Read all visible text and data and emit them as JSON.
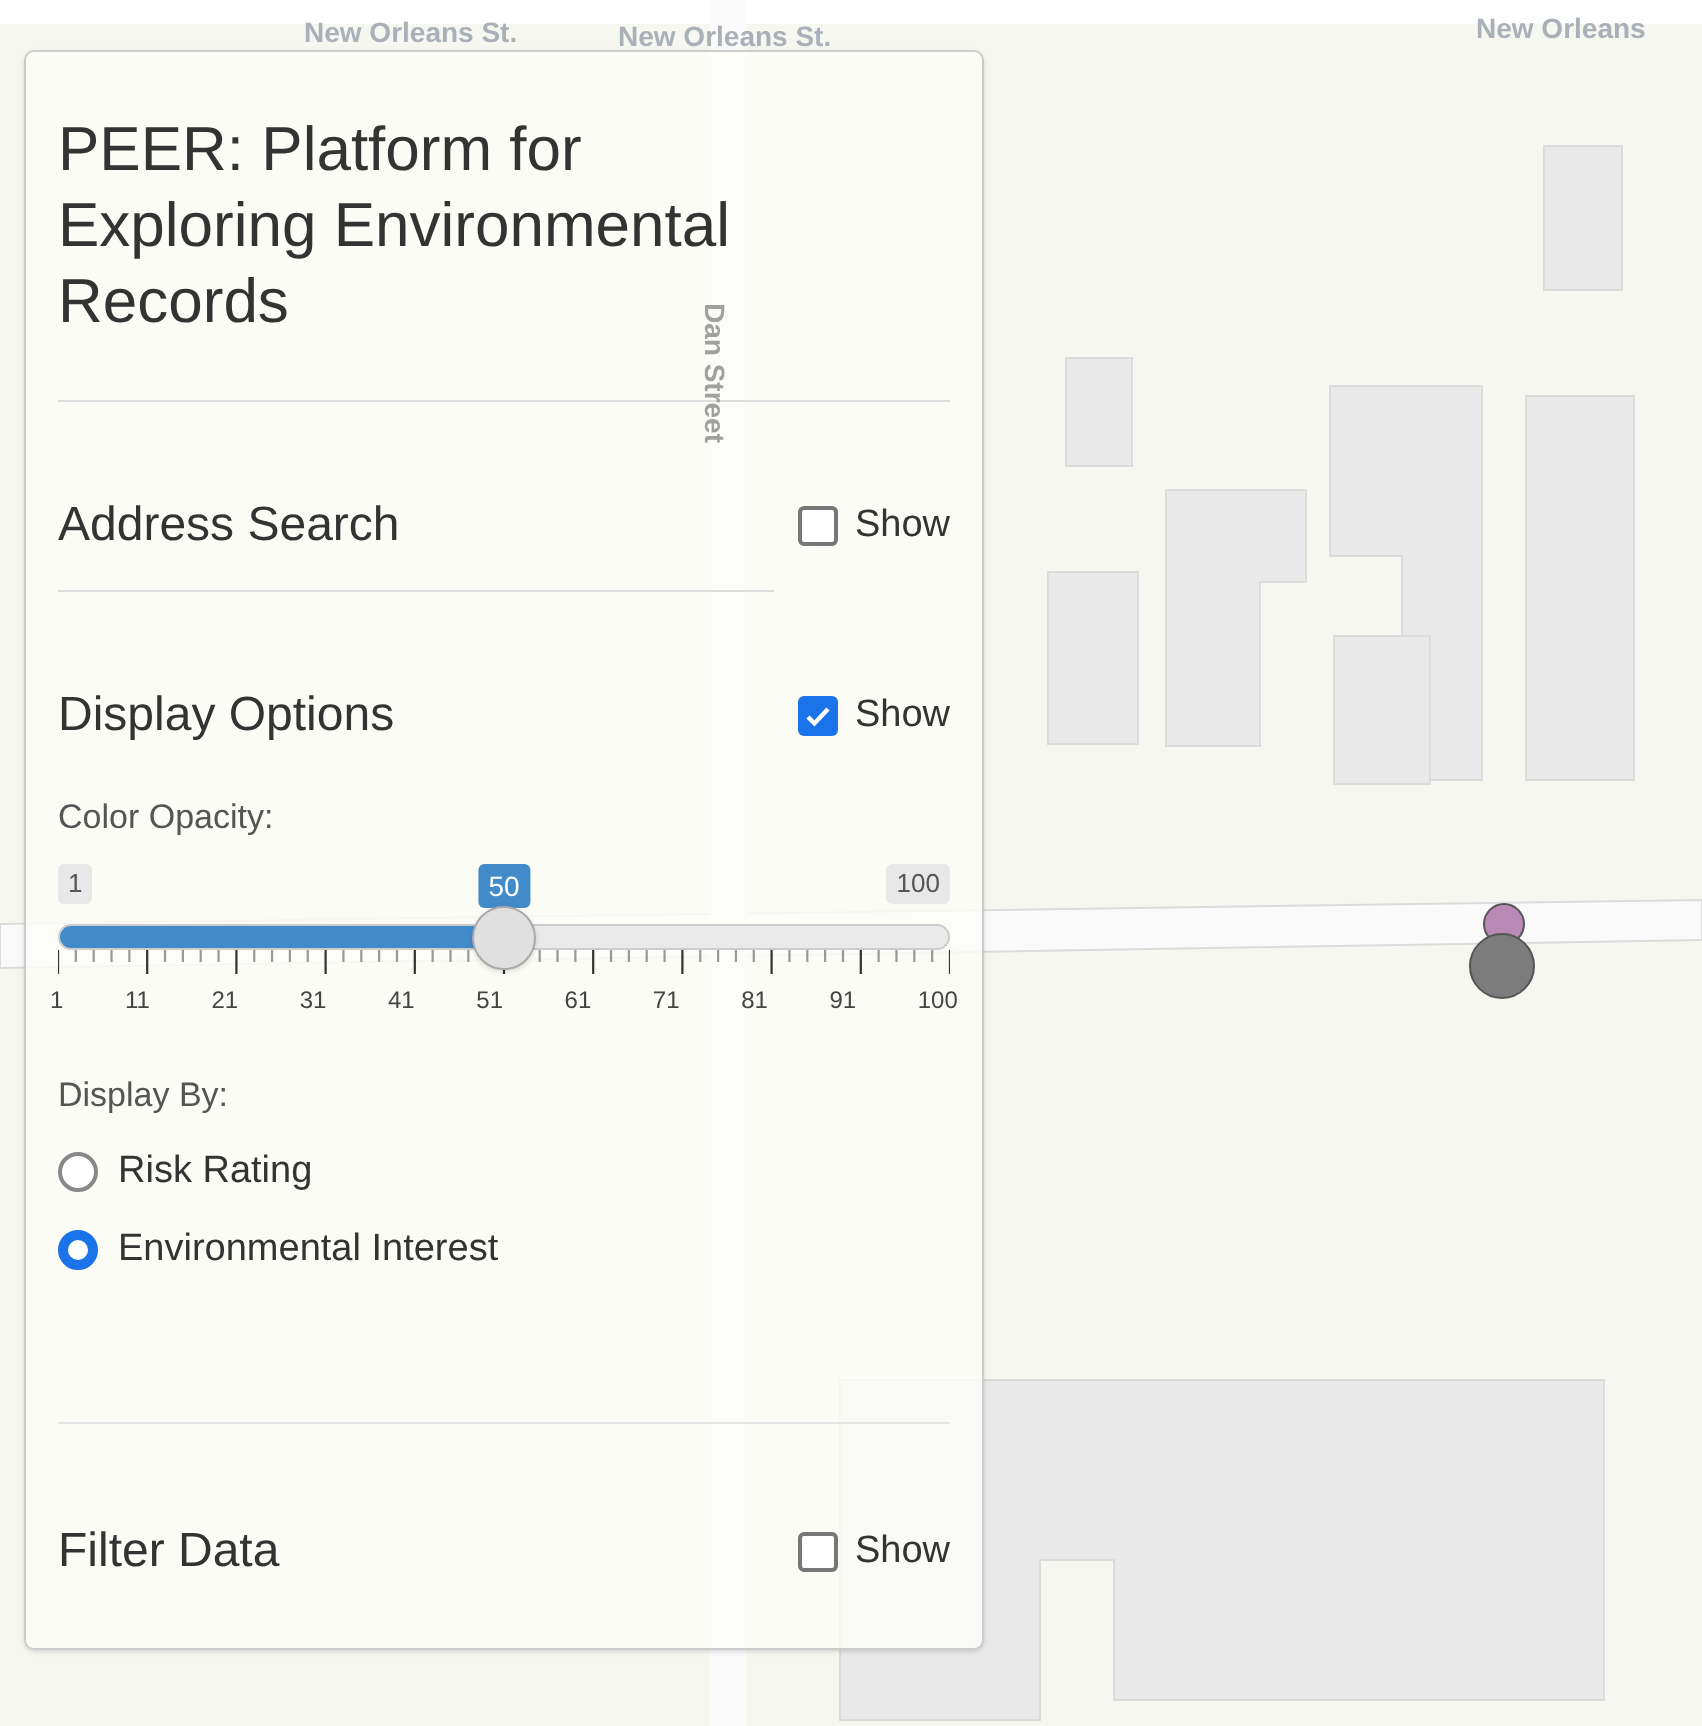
{
  "map": {
    "street_labels": [
      {
        "text": "New Orleans St.",
        "kind": "horizontal"
      },
      {
        "text": "New Orleans St.",
        "kind": "horizontal"
      },
      {
        "text": "New Orleans",
        "kind": "horizontal"
      },
      {
        "text": "Dan Street",
        "kind": "vertical"
      }
    ],
    "markers": [
      {
        "color": "#b98ab5"
      },
      {
        "color": "#7c7c7c"
      }
    ]
  },
  "panel": {
    "title": "PEER: Platform for Exploring Environmental Records",
    "sections": [
      {
        "title": "Address Search",
        "toggle_label": "Show",
        "checked": false
      },
      {
        "title": "Display Options",
        "toggle_label": "Show",
        "checked": true,
        "content": {
          "slider": {
            "label": "Color Opacity:",
            "min_label": "1",
            "max_label": "100",
            "value_label": "50",
            "level": 0.5,
            "tick_labels": [
              "1",
              "11",
              "21",
              "31",
              "41",
              "51",
              "61",
              "71",
              "81",
              "91",
              "100"
            ]
          },
          "radio_group": {
            "label": "Display By:",
            "options": [
              {
                "label": "Risk Rating",
                "selected": false
              },
              {
                "label": "Environmental Interest",
                "selected": true
              }
            ]
          }
        }
      },
      {
        "title": "Filter Data",
        "toggle_label": "Show",
        "checked": false
      }
    ]
  }
}
